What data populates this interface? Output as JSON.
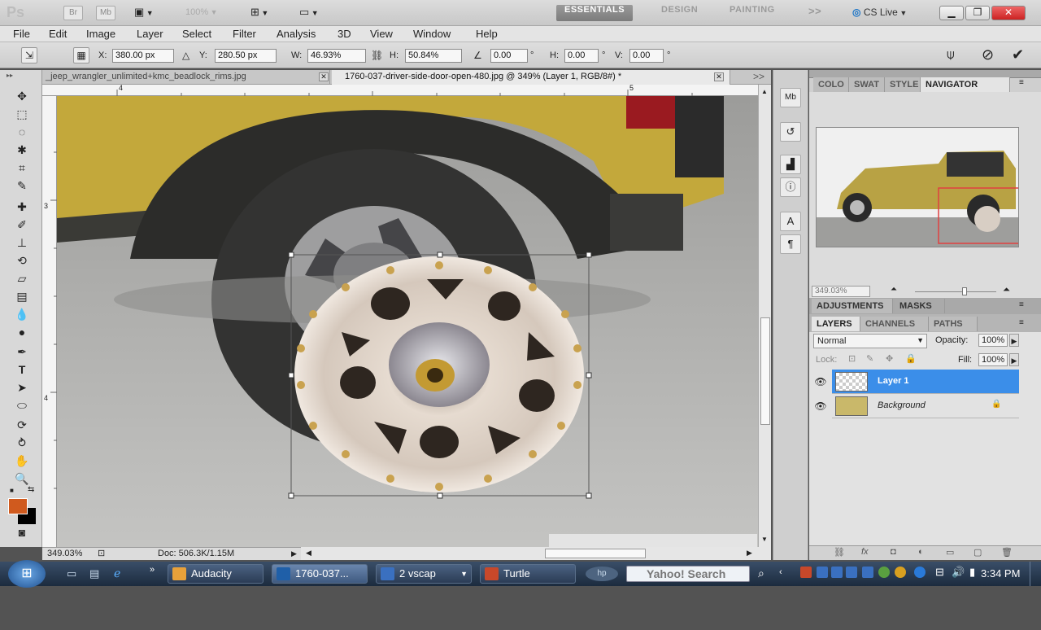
{
  "app": {
    "logo": "Ps",
    "workspaces": [
      "ESSENTIALS",
      "DESIGN",
      "PAINTING"
    ],
    "more": ">>",
    "cs_live": "CS Live",
    "zoom_display": "100%",
    "minibridge": "Mb",
    "bridge": "Br"
  },
  "menu": [
    "File",
    "Edit",
    "Image",
    "Layer",
    "Select",
    "Filter",
    "Analysis",
    "3D",
    "View",
    "Window",
    "Help"
  ],
  "options": {
    "x_label": "X:",
    "x_value": "380.00 px",
    "y_label": "Y:",
    "y_value": "280.50 px",
    "w_label": "W:",
    "w_value": "46.93%",
    "h_label": "H:",
    "h_value": "50.84%",
    "angle_value": "0.00",
    "hskew_label": "H:",
    "hskew_value": "0.00",
    "vskew_label": "V:",
    "vskew_value": "0.00",
    "degree": "°"
  },
  "tabs": [
    {
      "label": "_jeep_wrangler_unlimited+kmc_beadlock_rims.jpg"
    },
    {
      "label": "1760-037-driver-side-door-open-480.jpg @ 349% (Layer 1, RGB/8#) *"
    }
  ],
  "tab_more": ">>",
  "rulers": {
    "h": [
      "4",
      "5"
    ],
    "v": [
      "3",
      "4"
    ]
  },
  "status": {
    "zoom": "349.03%",
    "doc": "Doc: 506.3K/1.15M"
  },
  "panels": {
    "top_tabs": [
      "COLO",
      "SWAT",
      "STYLE",
      "NAVIGATOR"
    ],
    "navigator_zoom": "349.03%",
    "mid_tabs": [
      "ADJUSTMENTS",
      "MASKS"
    ],
    "layer_tabs": [
      "LAYERS",
      "CHANNELS",
      "PATHS"
    ],
    "blend_mode": "Normal",
    "opacity_label": "Opacity:",
    "opacity_value": "100%",
    "lock_label": "Lock:",
    "fill_label": "Fill:",
    "fill_value": "100%",
    "layers": [
      {
        "name": "Layer 1",
        "selected": true
      },
      {
        "name": "Background",
        "selected": false
      }
    ]
  },
  "taskbar": {
    "tasks": [
      {
        "label": "Audacity",
        "color": "#e8a13a"
      },
      {
        "label": "1760-037...",
        "color": "#1f5fa8"
      },
      {
        "label": "2 vscap",
        "color": "#3a70c0"
      },
      {
        "label": "Turtle",
        "color": "#c8482a"
      }
    ],
    "search": "Yahoo! Search",
    "time": "3:34 PM"
  },
  "colors": {
    "foreground": "#d05a1e",
    "background": "#000000",
    "selection": "#3b8ee9",
    "accent_red": "#e04040"
  }
}
